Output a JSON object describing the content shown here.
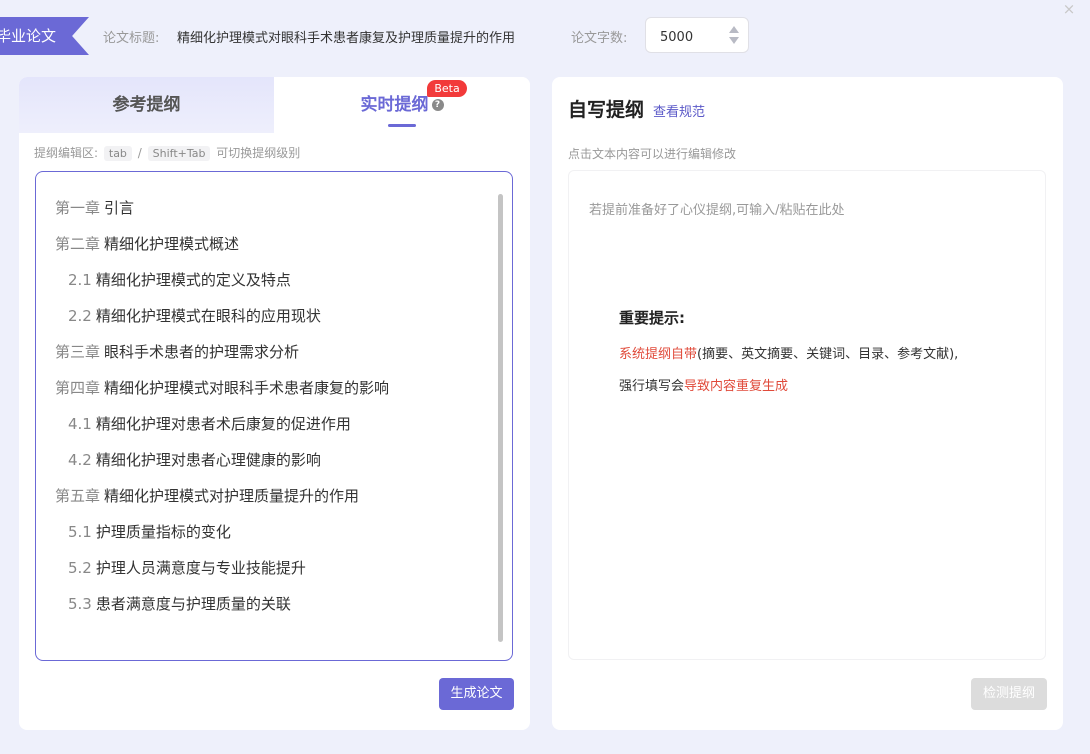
{
  "header": {
    "type_label": "毕业论文",
    "title_label": "论文标题:",
    "title_value": "精细化护理模式对眼科手术患者康复及护理质量提升的作用",
    "count_label": "论文字数:",
    "count_value": "5000",
    "close_icon": "close-icon"
  },
  "left": {
    "tabs": [
      {
        "label": "参考提纲",
        "active": false
      },
      {
        "label": "实时提纲",
        "active": true,
        "badge": "Beta"
      }
    ],
    "help_glyph": "?",
    "hint": {
      "prefix": "提纲编辑区:",
      "key1": "tab",
      "sep": "/",
      "key2": "Shift+Tab",
      "suffix": "可切换提纲级别"
    },
    "outline": [
      {
        "level": 1,
        "num": "第一章",
        "text": "引言"
      },
      {
        "level": 1,
        "num": "第二章",
        "text": "精细化护理模式概述"
      },
      {
        "level": 2,
        "num": "2.1",
        "text": "精细化护理模式的定义及特点"
      },
      {
        "level": 2,
        "num": "2.2",
        "text": "精细化护理模式在眼科的应用现状"
      },
      {
        "level": 1,
        "num": "第三章",
        "text": "眼科手术患者的护理需求分析"
      },
      {
        "level": 1,
        "num": "第四章",
        "text": "精细化护理模式对眼科手术患者康复的影响"
      },
      {
        "level": 2,
        "num": "4.1",
        "text": "精细化护理对患者术后康复的促进作用"
      },
      {
        "level": 2,
        "num": "4.2",
        "text": "精细化护理对患者心理健康的影响"
      },
      {
        "level": 1,
        "num": "第五章",
        "text": "精细化护理模式对护理质量提升的作用"
      },
      {
        "level": 2,
        "num": "5.1",
        "text": "护理质量指标的变化"
      },
      {
        "level": 2,
        "num": "5.2",
        "text": "护理人员满意度与专业技能提升"
      },
      {
        "level": 2,
        "num": "5.3",
        "text": "患者满意度与护理质量的关联"
      }
    ],
    "generate_button": "生成论文"
  },
  "right": {
    "title": "自写提纲",
    "spec_link": "查看规范",
    "hint": "点击文本内容可以进行编辑修改",
    "placeholder": "若提前准备好了心仪提纲,可输入/粘贴在此处",
    "notice": {
      "title": "重要提示:",
      "line1_red": "系统提纲自带",
      "line1_rest": "(摘要、英文摘要、关键词、目录、参考文献),",
      "line2_prefix": "强行填写会",
      "line2_red": "导致内容重复生成"
    },
    "check_button": "检测提纲"
  },
  "colors": {
    "accent": "#6b69d6",
    "warning_red": "#e04a3a",
    "beta_red": "#f23a3a",
    "disabled": "#dcdcdc",
    "background": "#eef0fb"
  }
}
